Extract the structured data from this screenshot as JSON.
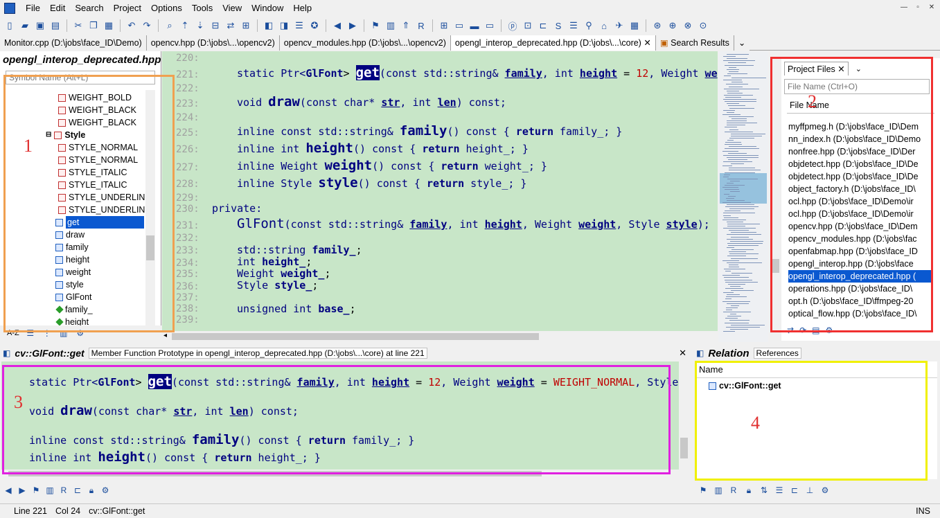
{
  "menu": {
    "items": [
      "File",
      "Edit",
      "Search",
      "Project",
      "Options",
      "Tools",
      "View",
      "Window",
      "Help"
    ]
  },
  "tabs": [
    {
      "label": "Monitor.cpp (D:\\jobs\\face_ID\\Demo)"
    },
    {
      "label": "opencv.hpp (D:\\jobs\\...\\opencv2)"
    },
    {
      "label": "opencv_modules.hpp (D:\\jobs\\...\\opencv2)"
    },
    {
      "label": "opengl_interop_deprecated.hpp (D:\\jobs\\...\\core)"
    },
    {
      "label": "Search Results"
    }
  ],
  "symbol_panel": {
    "title": "opengl_interop_deprecated.hpp",
    "search_placeholder": "Symbol Name (Alt+L)",
    "items": [
      {
        "label": "WEIGHT_BOLD"
      },
      {
        "label": "WEIGHT_BLACK"
      },
      {
        "label": "WEIGHT_BLACK"
      },
      {
        "label": "Style"
      },
      {
        "label": "STYLE_NORMAL"
      },
      {
        "label": "STYLE_NORMAL"
      },
      {
        "label": "STYLE_ITALIC"
      },
      {
        "label": "STYLE_ITALIC"
      },
      {
        "label": "STYLE_UNDERLIN"
      },
      {
        "label": "STYLE_UNDERLIN"
      },
      {
        "label": "get"
      },
      {
        "label": "draw"
      },
      {
        "label": "family"
      },
      {
        "label": "height"
      },
      {
        "label": "weight"
      },
      {
        "label": "style"
      },
      {
        "label": "GlFont"
      },
      {
        "label": "family_"
      },
      {
        "label": "height"
      }
    ],
    "sort_label": "A-Z"
  },
  "editor": {
    "lines": [
      {
        "n": "220:"
      },
      {
        "n": "221:"
      },
      {
        "n": "222:"
      },
      {
        "n": "223:"
      },
      {
        "n": "224:"
      },
      {
        "n": "225:"
      },
      {
        "n": "226:"
      },
      {
        "n": "227:"
      },
      {
        "n": "228:"
      },
      {
        "n": "229:"
      },
      {
        "n": "230:"
      },
      {
        "n": "231:"
      },
      {
        "n": "232:"
      },
      {
        "n": "233:"
      },
      {
        "n": "234:"
      },
      {
        "n": "235:"
      },
      {
        "n": "236:"
      },
      {
        "n": "237:"
      },
      {
        "n": "238:"
      },
      {
        "n": "239:"
      }
    ],
    "code": {
      "l221_a": "static Ptr<",
      "l221_b": "GlFont",
      "l221_c": "> ",
      "l221_get": "get",
      "l221_d": "(const std::string& ",
      "l221_e": "family",
      "l221_f": ", int ",
      "l221_g": "height",
      "l221_h": " = ",
      "l221_i": "12",
      "l221_j": ", Weight ",
      "l221_k": "we",
      "l223_a": "void ",
      "l223_b": "draw",
      "l223_c": "(const char* ",
      "l223_d": "str",
      "l223_e": ", int ",
      "l223_f": "len",
      "l223_g": ") const;",
      "l225_a": "inline const std::string& ",
      "l225_b": "family",
      "l225_c": "() const { ",
      "l225_d": "return",
      "l225_e": " family_; }",
      "l226_a": "inline int ",
      "l226_b": "height",
      "l226_c": "() const { ",
      "l226_d": "return",
      "l226_e": " height_; }",
      "l227_a": "inline Weight ",
      "l227_b": "weight",
      "l227_c": "() const { ",
      "l227_d": "return",
      "l227_e": " weight_; }",
      "l228_a": "inline Style ",
      "l228_b": "style",
      "l228_c": "() const { ",
      "l228_d": "return",
      "l228_e": " style_; }",
      "l230": "private:",
      "l231_a": "GlFont",
      "l231_b": "(const std::string& ",
      "l231_c": "family",
      "l231_d": ", int ",
      "l231_e": "height",
      "l231_f": ", Weight ",
      "l231_g": "weight",
      "l231_h": ", Style ",
      "l231_i": "style",
      "l231_j": ");",
      "l233_a": "std::string ",
      "l233_b": "family_",
      "l234_a": "int ",
      "l234_b": "height_",
      "l235_a": "Weight ",
      "l235_b": "weight_",
      "l236_a": "Style ",
      "l236_b": "style_",
      "l238_a": "unsigned int ",
      "l238_b": "base_"
    }
  },
  "project_panel": {
    "tab": "Project Files",
    "search_placeholder": "File Name (Ctrl+O)",
    "column": "File Name",
    "files": [
      {
        "label": "myffpmeg.h (D:\\jobs\\face_ID\\Dem"
      },
      {
        "label": "nn_index.h (D:\\jobs\\face_ID\\Demo"
      },
      {
        "label": "nonfree.hpp (D:\\jobs\\face_ID\\Der"
      },
      {
        "label": "objdetect.hpp (D:\\jobs\\face_ID\\De"
      },
      {
        "label": "objdetect.hpp (D:\\jobs\\face_ID\\De"
      },
      {
        "label": "object_factory.h (D:\\jobs\\face_ID\\"
      },
      {
        "label": "ocl.hpp (D:\\jobs\\face_ID\\Demo\\ir"
      },
      {
        "label": "ocl.hpp (D:\\jobs\\face_ID\\Demo\\ir"
      },
      {
        "label": "opencv.hpp (D:\\jobs\\face_ID\\Dem"
      },
      {
        "label": "opencv_modules.hpp (D:\\jobs\\fac"
      },
      {
        "label": "openfabmap.hpp (D:\\jobs\\face_ID"
      },
      {
        "label": "opengl_interop.hpp (D:\\jobs\\face"
      },
      {
        "label": "opengl_interop_deprecated.hpp ("
      },
      {
        "label": "operations.hpp (D:\\jobs\\face_ID\\"
      },
      {
        "label": "opt.h (D:\\jobs\\face_ID\\ffmpeg-20"
      },
      {
        "label": "optical_flow.hpp (D:\\jobs\\face_ID\\"
      }
    ]
  },
  "context": {
    "title": "cv::GlFont::get",
    "description": "Member Function Prototype in opengl_interop_deprecated.hpp (D:\\jobs\\...\\core) at line 221",
    "code": {
      "a_a": "static Ptr<",
      "a_b": "GlFont",
      "a_c": "> ",
      "a_get": "get",
      "a_d": "(const std::string& ",
      "a_e": "family",
      "a_f": ", int ",
      "a_g": "height",
      "a_h": " = ",
      "a_i": "12",
      "a_j": ", Weight ",
      "a_k": "weight",
      "a_l": " = ",
      "a_m": "WEIGHT_NORMAL",
      "a_n": ", Style",
      "b_a": "void ",
      "b_b": "draw",
      "b_c": "(const char* ",
      "b_d": "str",
      "b_e": ", int ",
      "b_f": "len",
      "b_g": ") const;",
      "c_a": "inline const std::string& ",
      "c_b": "family",
      "c_c": "() const { ",
      "c_d": "return",
      "c_e": " family_; }",
      "d_a": "inline int ",
      "d_b": "height",
      "d_c": "() const { ",
      "d_d": "return",
      "d_e": " height_; }"
    }
  },
  "relation": {
    "title": "Relation",
    "tab": "References",
    "column": "Name",
    "item": "cv::GlFont::get"
  },
  "status": {
    "line": "Line 221",
    "col": "Col 24",
    "symbol": "cv::GlFont::get",
    "mode": "INS"
  },
  "annotations": {
    "one": "1",
    "two": "2",
    "three": "3",
    "four": "4"
  },
  "colors": {
    "box1": "#f0a050",
    "box2": "#f03030",
    "box3": "#e020e0",
    "box4": "#f0f000",
    "editor_bg": "#c8e6c8",
    "selection": "#0a58d0"
  }
}
